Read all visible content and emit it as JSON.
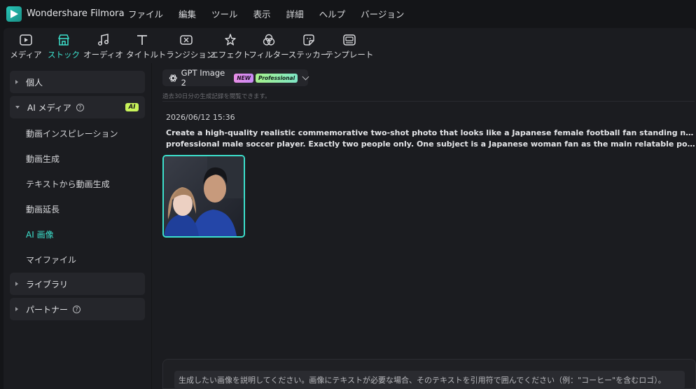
{
  "app": {
    "title": "Wondershare Filmora"
  },
  "menu": [
    "ファイル",
    "編集",
    "ツール",
    "表示",
    "詳細",
    "ヘルプ",
    "バージョン"
  ],
  "toolbar": [
    {
      "label": "メディア",
      "icon": "media-icon",
      "active": false
    },
    {
      "label": "ストック",
      "icon": "stock-store-icon",
      "active": true
    },
    {
      "label": "オーディオ",
      "icon": "music-note-icon",
      "active": false
    },
    {
      "label": "タイトル",
      "icon": "title-text-icon",
      "active": false
    },
    {
      "label": "トランジション",
      "icon": "transition-icon",
      "active": false
    },
    {
      "label": "エフェクト",
      "icon": "effect-sparkle-icon",
      "active": false
    },
    {
      "label": "フィルター",
      "icon": "filter-icon",
      "active": false
    },
    {
      "label": "ステッカー",
      "icon": "sticker-icon",
      "active": false
    },
    {
      "label": "テンプレート",
      "icon": "template-icon",
      "active": false
    }
  ],
  "sidebar": {
    "personal": "個人",
    "ai_media": "AI メディア",
    "ai_badge": "AI",
    "ai_items": [
      "動画インスピレーション",
      "動画生成",
      "テキストから動画生成",
      "動画延長",
      "AI 画像",
      "マイファイル"
    ],
    "active_item": "AI 画像",
    "library": "ライブラリ",
    "partner": "パートナー"
  },
  "main": {
    "model_name": "GPT Image 2",
    "badge_new": "NEW",
    "badge_pro": "Professional",
    "notice": "過去30日分の生成記録を閲覧できます。",
    "timestamp": "2026/06/12 15:36",
    "prompt_line1": "Create a high-quality realistic commemorative two-shot photo that looks like a Japanese female football fan standing next to her favorite",
    "prompt_line2": "professional male soccer player. Exactly two people only. One subject is a Japanese woman fan as the main relatable point-of-view character. T...",
    "input_placeholder": "生成したい画像を説明してください。画像にテキストが必要な場合、そのテキストを引用符で囲んでください（例：\"コーヒー\"を含むロゴ）。"
  },
  "colors": {
    "accent": "#3ce0cc",
    "ai_badge": "#c8f35a"
  }
}
